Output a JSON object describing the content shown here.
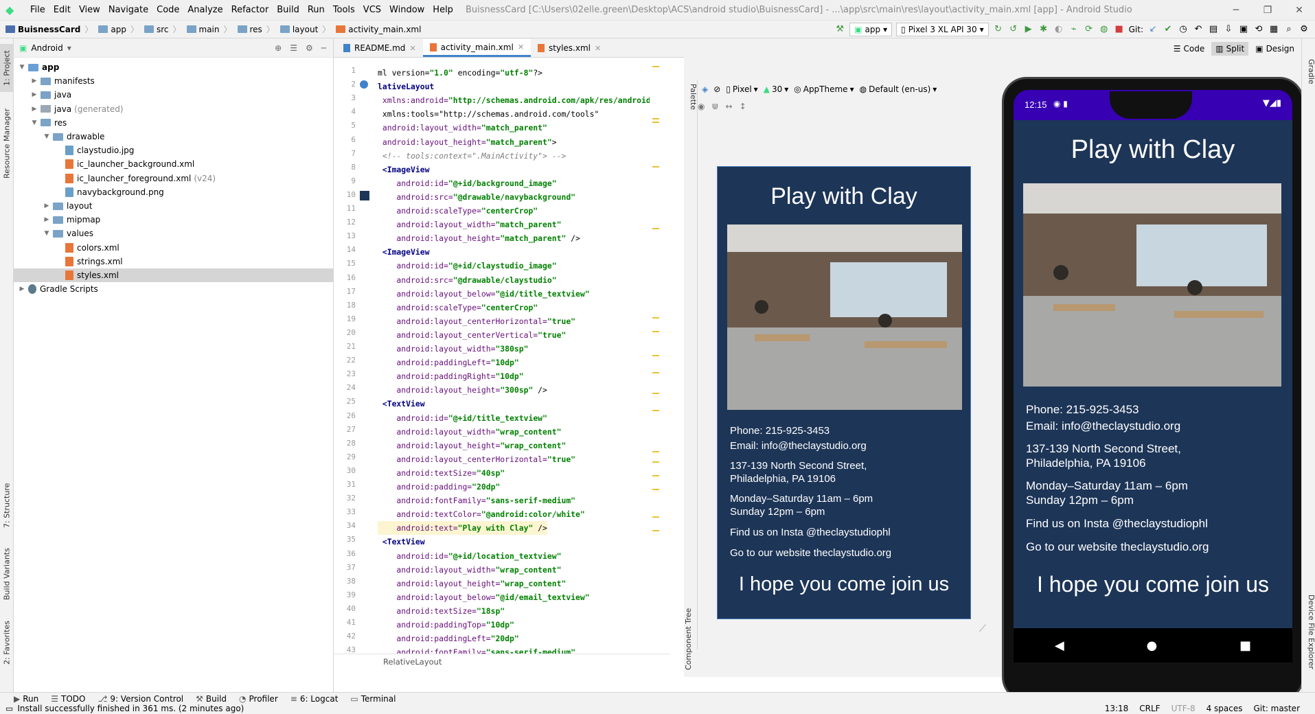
{
  "window": {
    "title": "BuisnessCard [C:\\Users\\02elle.green\\Desktop\\ACS\\android studio\\BuisnessCard] - ...\\app\\src\\main\\res\\layout\\activity_main.xml [app] - Android Studio",
    "menu": [
      "File",
      "Edit",
      "View",
      "Navigate",
      "Code",
      "Analyze",
      "Refactor",
      "Build",
      "Run",
      "Tools",
      "VCS",
      "Window",
      "Help"
    ]
  },
  "breadcrumb": [
    "BuisnessCard",
    "app",
    "src",
    "main",
    "res",
    "layout",
    "activity_main.xml"
  ],
  "toolbar": {
    "run_config": "app",
    "device": "Pixel 3 XL API 30",
    "git_label": "Git:"
  },
  "left_strip": {
    "project": "1: Project",
    "resource_manager": "Resource Manager",
    "structure": "7: Structure",
    "build_variants": "Build Variants",
    "favorites": "2: Favorites"
  },
  "right_strip": {
    "gradle": "Gradle",
    "device_file_explorer": "Device File Explorer"
  },
  "project_panel": {
    "view_mode": "Android",
    "tree": [
      {
        "label": "app",
        "indent": 0,
        "kind": "module",
        "expanded": true,
        "bold": true
      },
      {
        "label": "manifests",
        "indent": 1,
        "kind": "folder",
        "expanded": false
      },
      {
        "label": "java",
        "indent": 1,
        "kind": "folder",
        "expanded": false
      },
      {
        "label": "java",
        "suffix": "(generated)",
        "indent": 1,
        "kind": "folder-gray",
        "expanded": false
      },
      {
        "label": "res",
        "indent": 1,
        "kind": "folder",
        "expanded": true
      },
      {
        "label": "drawable",
        "indent": 2,
        "kind": "folder",
        "expanded": true
      },
      {
        "label": "claystudio.jpg",
        "indent": 3,
        "kind": "img"
      },
      {
        "label": "ic_launcher_background.xml",
        "indent": 3,
        "kind": "xml"
      },
      {
        "label": "ic_launcher_foreground.xml",
        "suffix": "(v24)",
        "indent": 3,
        "kind": "xml"
      },
      {
        "label": "navybackground.png",
        "indent": 3,
        "kind": "img"
      },
      {
        "label": "layout",
        "indent": 2,
        "kind": "folder",
        "expanded": false
      },
      {
        "label": "mipmap",
        "indent": 2,
        "kind": "folder",
        "expanded": false
      },
      {
        "label": "values",
        "indent": 2,
        "kind": "folder",
        "expanded": true
      },
      {
        "label": "colors.xml",
        "indent": 3,
        "kind": "xml"
      },
      {
        "label": "strings.xml",
        "indent": 3,
        "kind": "xml"
      },
      {
        "label": "styles.xml",
        "indent": 3,
        "kind": "xml",
        "selected": true
      },
      {
        "label": "Gradle Scripts",
        "indent": 0,
        "kind": "gradle",
        "expanded": false
      }
    ]
  },
  "editor_tabs": [
    {
      "label": "README.md",
      "active": false
    },
    {
      "label": "activity_main.xml",
      "active": true
    },
    {
      "label": "styles.xml",
      "active": false
    }
  ],
  "code_lines": [
    [
      [
        "plain",
        "ml version="
      ],
      [
        "val",
        "\"1.0\""
      ],
      [
        "plain",
        " encoding="
      ],
      [
        "val",
        "\"utf-8\""
      ],
      [
        "plain",
        "?>"
      ]
    ],
    [
      [
        "tag",
        "lativeLayout"
      ]
    ],
    [
      [
        "ns",
        " xmlns:android="
      ],
      [
        "val",
        "\"http://schemas.android.com/apk/res/android\""
      ]
    ],
    [
      [
        "plain",
        " xmlns:tools=\"http://schemas.android.com/tools\""
      ]
    ],
    [
      [
        "attr",
        " android:layout_width="
      ],
      [
        "val",
        "\"match_parent\""
      ]
    ],
    [
      [
        "attr",
        " android:layout_height="
      ],
      [
        "val",
        "\"match_parent\""
      ],
      [
        "plain",
        ">"
      ]
    ],
    [
      [
        "cmt",
        " <!-- tools:context=\".MainActivity\"> -->"
      ]
    ],
    [
      [
        "tag",
        " <ImageView"
      ]
    ],
    [
      [
        "attr",
        "    android:id="
      ],
      [
        "val",
        "\"@+id/background_image\""
      ]
    ],
    [
      [
        "attr",
        "    android:src="
      ],
      [
        "val",
        "\"@drawable/navybackground\""
      ]
    ],
    [
      [
        "attr",
        "    android:scaleType="
      ],
      [
        "val",
        "\"centerCrop\""
      ]
    ],
    [
      [
        "attr",
        "    android:layout_width="
      ],
      [
        "val",
        "\"match_parent\""
      ]
    ],
    [
      [
        "attr",
        "    android:layout_height="
      ],
      [
        "val",
        "\"match_parent\""
      ],
      [
        "plain",
        " />"
      ]
    ],
    [
      [
        "tag",
        " <ImageView"
      ]
    ],
    [
      [
        "attr",
        "    android:id="
      ],
      [
        "val",
        "\"@+id/claystudio_image\""
      ]
    ],
    [
      [
        "attr",
        "    android:src="
      ],
      [
        "val",
        "\"@drawable/claystudio\""
      ]
    ],
    [
      [
        "attr",
        "    android:layout_below="
      ],
      [
        "val",
        "\"@id/title_textview\""
      ]
    ],
    [
      [
        "attr",
        "    android:scaleType="
      ],
      [
        "val",
        "\"centerCrop\""
      ]
    ],
    [
      [
        "attr",
        "    android:layout_centerHorizontal="
      ],
      [
        "val",
        "\"true\""
      ]
    ],
    [
      [
        "attr",
        "    android:layout_centerVertical="
      ],
      [
        "val",
        "\"true\""
      ]
    ],
    [
      [
        "attr",
        "    android:layout_width="
      ],
      [
        "val",
        "\"380sp\""
      ]
    ],
    [
      [
        "attr",
        "    android:paddingLeft="
      ],
      [
        "val",
        "\"10dp\""
      ]
    ],
    [
      [
        "attr",
        "    android:paddingRight="
      ],
      [
        "val",
        "\"10dp\""
      ]
    ],
    [
      [
        "attr",
        "    android:layout_height="
      ],
      [
        "val",
        "\"300sp\""
      ],
      [
        "plain",
        " />"
      ]
    ],
    [
      [
        "tag",
        " <TextView"
      ]
    ],
    [
      [
        "attr",
        "    android:id="
      ],
      [
        "val",
        "\"@+id/title_textview\""
      ]
    ],
    [
      [
        "attr",
        "    android:layout_width="
      ],
      [
        "val",
        "\"wrap_content\""
      ]
    ],
    [
      [
        "attr",
        "    android:layout_height="
      ],
      [
        "val",
        "\"wrap_content\""
      ]
    ],
    [
      [
        "attr",
        "    android:layout_centerHorizontal="
      ],
      [
        "val",
        "\"true\""
      ]
    ],
    [
      [
        "attr",
        "    android:textSize="
      ],
      [
        "val",
        "\"40sp\""
      ]
    ],
    [
      [
        "attr",
        "    android:padding="
      ],
      [
        "val",
        "\"20dp\""
      ]
    ],
    [
      [
        "attr",
        "    android:fontFamily="
      ],
      [
        "val",
        "\"sans-serif-medium\""
      ]
    ],
    [
      [
        "attr",
        "    android:textColor="
      ],
      [
        "val",
        "\"@android:color/white\""
      ]
    ],
    [
      [
        "attr",
        "    android:text="
      ],
      [
        "val",
        "\"Play with Clay\""
      ],
      [
        "plain",
        " />"
      ]
    ],
    [
      [
        "tag",
        " <TextView"
      ]
    ],
    [
      [
        "attr",
        "    android:id="
      ],
      [
        "val",
        "\"@+id/location_textview\""
      ]
    ],
    [
      [
        "attr",
        "    android:layout_width="
      ],
      [
        "val",
        "\"wrap_content\""
      ]
    ],
    [
      [
        "attr",
        "    android:layout_height="
      ],
      [
        "val",
        "\"wrap_content\""
      ]
    ],
    [
      [
        "attr",
        "    android:layout_below="
      ],
      [
        "val",
        "\"@id/email_textview\""
      ]
    ],
    [
      [
        "attr",
        "    android:textSize="
      ],
      [
        "val",
        "\"18sp\""
      ]
    ],
    [
      [
        "attr",
        "    android:paddingTop="
      ],
      [
        "val",
        "\"10dp\""
      ]
    ],
    [
      [
        "attr",
        "    android:paddingLeft="
      ],
      [
        "val",
        "\"20dp\""
      ]
    ],
    [
      [
        "attr",
        "    android:fontFamily="
      ],
      [
        "val",
        "\"sans-serif-medium\""
      ]
    ]
  ],
  "editor_footer": "RelativeLayout",
  "designer": {
    "view_modes": [
      "Code",
      "Split",
      "Design"
    ],
    "palette": "Palette",
    "component_tree": "Component Tree",
    "device": "Pixel",
    "api": "30",
    "theme": "AppTheme",
    "locale": "Default (en-us)"
  },
  "app_preview": {
    "title": "Play with Clay",
    "phone": "Phone: 215-925-3453",
    "email": "Email: info@theclaystudio.org",
    "address1": "137-139 North Second Street,",
    "address2": "Philadelphia, PA 19106",
    "hours1": "Monday–Saturday 11am – 6pm",
    "hours2": "Sunday 12pm – 6pm",
    "insta": "Find us on Insta @theclaystudiophl",
    "website": "Go to our website theclaystudio.org",
    "footer": "I hope you come join us",
    "status_time": "12:15",
    "bg_color": "#1d3557"
  },
  "bottom_tabs": [
    "Run",
    "TODO",
    "9: Version Control",
    "Build",
    "Profiler",
    "6: Logcat",
    "Terminal"
  ],
  "status": {
    "message": "Install successfully finished in 361 ms. (2 minutes ago)",
    "position": "13:18",
    "line_sep": "CRLF",
    "encoding": "UTF-8",
    "indent": "4 spaces",
    "git": "Git: master"
  }
}
